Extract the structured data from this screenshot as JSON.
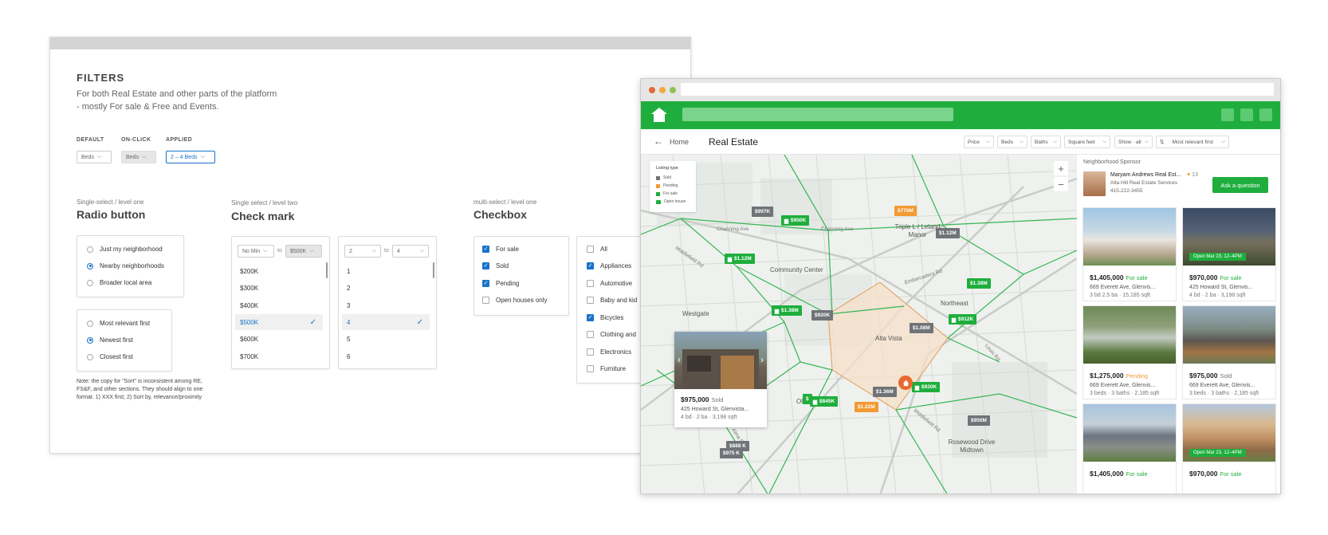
{
  "filters": {
    "title": "FILTERS",
    "description_line1": "For both Real Estate and other parts of the platform",
    "description_line2": "- mostly For sale & Free and Events.",
    "states": [
      {
        "label": "DEFAULT",
        "value": "Beds"
      },
      {
        "label": "ON-CLICK",
        "value": "Beds"
      },
      {
        "label": "APPLIED",
        "value": "2 – 4 Beds"
      }
    ],
    "radio": {
      "subtitle": "Single-select / level one",
      "title": "Radio button",
      "group1": [
        {
          "label": "Just my neighborhood",
          "selected": false
        },
        {
          "label": "Nearby neighborhoods",
          "selected": true
        },
        {
          "label": "Broader local area",
          "selected": false
        }
      ],
      "group2": [
        {
          "label": "Most relevant first",
          "selected": false
        },
        {
          "label": "Newest first",
          "selected": true
        },
        {
          "label": "Closest first",
          "selected": false
        }
      ],
      "note": "Note: the copy for \"Sort\" is inconsistent among RE, FS&F, and other sections. They should align to one format. 1) XXX first; 2) Sort by, relevance/proximity"
    },
    "checkmark": {
      "subtitle": "Single select / level two",
      "title": "Check mark",
      "price": {
        "min": "No Min",
        "to": "to",
        "max": "$500K",
        "options": [
          "$200K",
          "$300K",
          "$400K",
          "$500K",
          "$600K",
          "$700K"
        ],
        "selected": "$500K"
      },
      "beds": {
        "min": "2",
        "to": "to",
        "max": "4",
        "options": [
          "1",
          "2",
          "3",
          "4",
          "5",
          "6"
        ],
        "selected": "4"
      }
    },
    "checkbox": {
      "subtitle": "multi-select / level one",
      "title": "Checkbox",
      "group1": [
        {
          "label": "For sale",
          "checked": true
        },
        {
          "label": "Sold",
          "checked": true
        },
        {
          "label": "Pending",
          "checked": true
        },
        {
          "label": "Open houses only",
          "checked": false
        }
      ],
      "group2": [
        {
          "label": "All",
          "checked": false
        },
        {
          "label": "Appliances",
          "checked": true
        },
        {
          "label": "Automotive",
          "checked": false
        },
        {
          "label": "Baby and kid",
          "checked": false
        },
        {
          "label": "Bicycles",
          "checked": true
        },
        {
          "label": "Clothing and",
          "checked": false
        },
        {
          "label": "Electronics",
          "checked": false
        },
        {
          "label": "Furniture",
          "checked": false
        }
      ]
    }
  },
  "browser": {
    "colors": {
      "brand": "#1fae3d",
      "sold": "#707478",
      "pending": "#f39a33"
    },
    "back_label": "Home",
    "page_title": "Real Estate",
    "toolbar": [
      {
        "label": "Price"
      },
      {
        "label": "Beds"
      },
      {
        "label": "Baths"
      },
      {
        "label": "Square feet"
      },
      {
        "label": "Show · all"
      },
      {
        "label": "Most relevant first"
      }
    ],
    "legend": {
      "title": "Listing type",
      "items": [
        {
          "label": "Sold",
          "color": "#707478"
        },
        {
          "label": "Pending",
          "color": "#f39a33"
        },
        {
          "label": "For sale",
          "color": "#1fae3d"
        },
        {
          "label": "Open house",
          "color": "#1fae3d"
        }
      ]
    },
    "map_labels": [
      "Community Center",
      "Triple L / Leland Manor",
      "Northeast",
      "Westgate",
      "Alta Vista",
      "Old C",
      "Rosewood Drive Midtown"
    ],
    "street_labels": [
      "Channing Ave",
      "Channing Ave",
      "Middlefield Rd",
      "Embarcadero Rd",
      "Louis Rd",
      "Middlefield Rd",
      "Alma St"
    ],
    "pins": [
      {
        "label": "$997K",
        "type": "sold"
      },
      {
        "label": "$950K",
        "type": "forsale"
      },
      {
        "label": "$770M",
        "type": "pending"
      },
      {
        "label": "$1.12M",
        "type": "sold"
      },
      {
        "label": "$1.12M",
        "type": "forsale"
      },
      {
        "label": "$1.38M",
        "type": "forsale"
      },
      {
        "label": "$1.38M",
        "type": "forsale"
      },
      {
        "label": "$920K",
        "type": "sold"
      },
      {
        "label": "$912K",
        "type": "forsale"
      },
      {
        "label": "$1.08M",
        "type": "sold"
      },
      {
        "label": "$1.36M",
        "type": "sold"
      },
      {
        "label": "$920K",
        "type": "forsale"
      },
      {
        "label": "$",
        "type": "forsale"
      },
      {
        "label": "$845K",
        "type": "forsale"
      },
      {
        "label": "$1.22M",
        "type": "pending"
      },
      {
        "label": "$950M",
        "type": "sold"
      },
      {
        "label": "$888 K",
        "type": "sold"
      },
      {
        "label": "$975 K",
        "type": "sold"
      }
    ],
    "popup": {
      "price": "$975,000",
      "status": "Sold",
      "address": "425 Howard St, Glenvista...",
      "meta": "4 bd · 2 ba · 3,198 sqft"
    },
    "sponsor": {
      "heading": "Neighborhood Sponsor",
      "name": "Maryam Andrews Real Est...",
      "likes": "13",
      "company": "Alta Hill Real Estate Services",
      "phone": "415-222-3455",
      "button": "Ask a question"
    },
    "listings": [
      {
        "price": "$1,405,000",
        "status": "For sale",
        "st": "g",
        "address": "669 Everett Ave, Glenvis...",
        "meta": "3 bd 2.5 ba · 15,185 sqft",
        "badge": ""
      },
      {
        "price": "$970,000",
        "status": "For sale",
        "st": "g",
        "address": "425 Howard St, Glenvis...",
        "meta": "4 bd · 2 ba · 3,198 sqft",
        "badge": "Open Mar 23, 12–4PM"
      },
      {
        "price": "$1,275,000",
        "status": "Pending",
        "st": "o",
        "address": "669 Everett Ave, Glenvis...",
        "meta": "3 beds · 3 baths · 2,185 sqft",
        "badge": ""
      },
      {
        "price": "$975,000",
        "status": "Sold",
        "st": "gr",
        "address": "669 Everett Ave, Glenvis...",
        "meta": "3 beds · 3 baths · 2,185 sqft",
        "badge": ""
      },
      {
        "price": "$1,405,000",
        "status": "For sale",
        "st": "g",
        "address": "",
        "meta": "",
        "badge": ""
      },
      {
        "price": "$970,000",
        "status": "For sale",
        "st": "g",
        "address": "",
        "meta": "",
        "badge": "Open Mar 23, 12–4PM"
      }
    ]
  }
}
